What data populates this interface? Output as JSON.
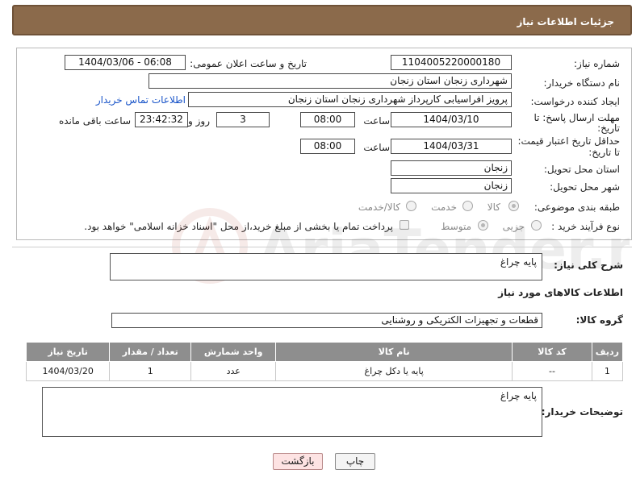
{
  "header": {
    "title": "جزئیات اطلاعات نیاز"
  },
  "form": {
    "need_number": {
      "label": "شماره نیاز:",
      "value": "1104005220000180"
    },
    "announce_datetime": {
      "label": "تاریخ و ساعت اعلان عمومی:",
      "value": "1404/03/06 - 06:08"
    },
    "buyer_org": {
      "label": "نام دستگاه خریدار:",
      "value": "شهرداری زنجان استان زنجان"
    },
    "requester": {
      "label": "ایجاد کننده درخواست:",
      "value": "پرویز افراسیابی کارپرداز شهرداری زنجان استان زنجان"
    },
    "buyer_contact_link": "اطلاعات تماس خریدار",
    "reply_deadline": {
      "label_line1": "مهلت ارسال پاسخ: تا",
      "label_line2": "تاریخ:",
      "date": "1404/03/10",
      "time_label": "ساعت",
      "time": "08:00",
      "days": "3",
      "days_label": "روز و",
      "remaining": "23:42:32",
      "remaining_label": "ساعت باقی مانده"
    },
    "price_validity": {
      "label_line1": "حداقل تاریخ اعتبار قیمت:",
      "label_line2": "تا تاریخ:",
      "date": "1404/03/31",
      "time_label": "ساعت",
      "time": "08:00"
    },
    "delivery_province": {
      "label": "استان محل تحویل:",
      "value": "زنجان"
    },
    "delivery_city": {
      "label": "شهر محل تحویل:",
      "value": "زنجان"
    },
    "category": {
      "label": "طبقه بندی موضوعی:",
      "options": [
        "کالا",
        "خدمت",
        "کالا/خدمت"
      ],
      "selected": "کالا"
    },
    "purchase_process": {
      "label": "نوع فرآیند خرید :",
      "options": [
        "جزیی",
        "متوسط"
      ],
      "selected": "متوسط",
      "payment_note": "پرداخت تمام یا بخشی از مبلغ خرید،از محل \"اسناد خزانه اسلامی\" خواهد بود."
    }
  },
  "description": {
    "label": "شرح کلی نیاز:",
    "value": "پایه چراغ"
  },
  "goods_info": {
    "heading": "اطلاعات کالاهای مورد نیاز",
    "group_label": "گروه کالا:",
    "group_value": "قطعات و تجهیزات الکتریکی و روشنایی"
  },
  "table": {
    "headers": [
      "ردیف",
      "کد کالا",
      "نام کالا",
      "واحد شمارش",
      "تعداد / مقدار",
      "تاریخ نیاز"
    ],
    "rows": [
      [
        "1",
        "--",
        "پایه یا دکل چراغ",
        "عدد",
        "1",
        "1404/03/20"
      ]
    ]
  },
  "buyer_notes": {
    "label": "توضیحات خریدار:",
    "value": "پایه چراغ"
  },
  "buttons": {
    "print": "چاپ",
    "back": "بازگشت"
  },
  "watermark": "AriaTender.net"
}
